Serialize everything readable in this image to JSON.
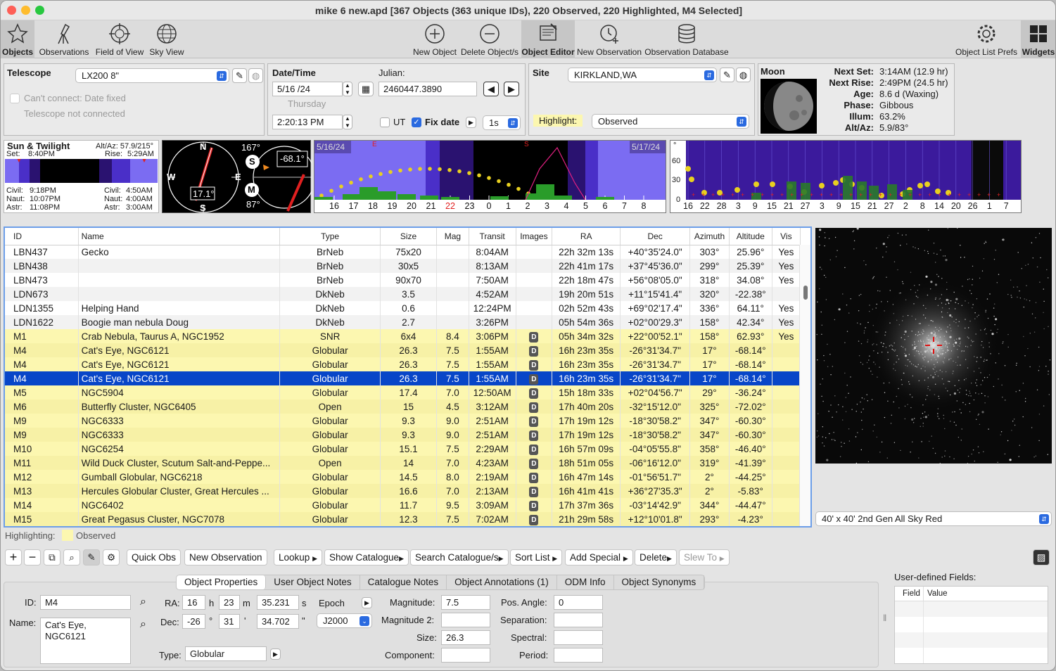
{
  "window": {
    "title": "mike 6 new.apd [367 Objects (363 unique IDs), 220 Observed, 220 Highlighted, M4 Selected]"
  },
  "toolbar": {
    "objects": "Objects",
    "observations": "Observations",
    "fov": "Field of View",
    "sky_view": "Sky View",
    "new_object": "New Object",
    "delete_objects": "Delete Object/s",
    "object_editor": "Object Editor",
    "new_observation": "New Observation",
    "obs_database": "Observation Database",
    "list_prefs": "Object List Prefs",
    "widgets": "Widgets"
  },
  "telescope": {
    "label": "Telescope",
    "value": "LX200 8\"",
    "cant_connect": "Can't connect: Date fixed",
    "status": "Telescope not connected"
  },
  "datetime": {
    "label": "Date/Time",
    "julian_label": "Julian:",
    "date": "5/16 /24",
    "weekday": "Thursday",
    "julian": "2460447.3890",
    "time": "2:20:13  PM",
    "ut": "UT",
    "fix_date": "Fix date",
    "step": "1s"
  },
  "site": {
    "label": "Site",
    "value": "KIRKLAND,WA",
    "highlight_label": "Highlight:",
    "highlight_value": "Observed"
  },
  "moon": {
    "label": "Moon",
    "rows": [
      {
        "k": "Next Set:",
        "v": "3:14AM (12.9 hr)"
      },
      {
        "k": "Next Rise:",
        "v": "2:49PM (24.5 hr)"
      },
      {
        "k": "Age:",
        "v": "8.6 d (Waxing)"
      },
      {
        "k": "Phase:",
        "v": "Gibbous"
      },
      {
        "k": "Illum:",
        "v": "63.2%"
      },
      {
        "k": "Alt/Az:",
        "v": "5.9/83°"
      }
    ]
  },
  "sun": {
    "title": "Sun & Twilight",
    "altaz": "Alt/Az: 57.9/215°",
    "set": "Set:",
    "set_time": "8:40PM",
    "rise": "Rise:",
    "rise_time": "5:29AM",
    "civil": "Civil:",
    "naut": "Naut:",
    "astr": "Astr:",
    "civil_e": "9:18PM",
    "naut_e": "10:07PM",
    "astr_e": "11:08PM",
    "civil_m": "4:50AM",
    "naut_m": "4:00AM",
    "astr_m": "3:00AM"
  },
  "compass": {
    "n": "N",
    "s": "S",
    "e": "E",
    "w": "W",
    "heading": "17.1°",
    "az1": "167°",
    "s_marker": "S",
    "m_marker": "M",
    "az2": "87°",
    "alt": "-68.1°"
  },
  "altchart": {
    "start": "5/16/24",
    "end": "5/17/24",
    "e": "E",
    "s": "S",
    "hours": [
      "16",
      "17",
      "18",
      "19",
      "20",
      "21",
      "22",
      "23",
      "0",
      "1",
      "2",
      "3",
      "4",
      "5",
      "6",
      "7",
      "8"
    ],
    "red_hour": "22"
  },
  "yearchart": {
    "y1": "60",
    "y2": "30",
    "y0": "0",
    "deg": "°",
    "ticks": [
      "16",
      "22",
      "28",
      "3",
      "9",
      "15",
      "21",
      "27",
      "3",
      "9",
      "15",
      "21",
      "27",
      "2",
      "8",
      "14",
      "20",
      "26",
      "1",
      "7"
    ]
  },
  "grid": {
    "headers": [
      "ID",
      "Name",
      "Type",
      "Size",
      "Mag",
      "Transit",
      "Images",
      "RA",
      "Dec",
      "Azimuth",
      "Altitude",
      "Vis"
    ],
    "rows": [
      {
        "id": "LBN437",
        "name": "Gecko",
        "type": "BrNeb",
        "size": "75x20",
        "mag": "",
        "transit": "8:04AM",
        "img": "",
        "ra": "22h 32m 13s",
        "dec": "+40°35'24.0\"",
        "az": "303°",
        "alt": "25.96°",
        "vis": "Yes",
        "state": "plain"
      },
      {
        "id": "LBN438",
        "name": "",
        "type": "BrNeb",
        "size": "30x5",
        "mag": "",
        "transit": "8:13AM",
        "img": "",
        "ra": "22h 41m 17s",
        "dec": "+37°45'36.0\"",
        "az": "299°",
        "alt": "25.39°",
        "vis": "Yes",
        "state": "alt"
      },
      {
        "id": "LBN473",
        "name": "",
        "type": "BrNeb",
        "size": "90x70",
        "mag": "",
        "transit": "7:50AM",
        "img": "",
        "ra": "22h 18m 47s",
        "dec": "+56°08'05.0\"",
        "az": "318°",
        "alt": "34.08°",
        "vis": "Yes",
        "state": "plain"
      },
      {
        "id": "LDN673",
        "name": "",
        "type": "DkNeb",
        "size": "3.5",
        "mag": "",
        "transit": "4:52AM",
        "img": "",
        "ra": "19h 20m 51s",
        "dec": "+11°15'41.4\"",
        "az": "320°",
        "alt": "-22.38°",
        "vis": "",
        "state": "alt"
      },
      {
        "id": "LDN1355",
        "name": "Helping Hand",
        "type": "DkNeb",
        "size": "0.6",
        "mag": "",
        "transit": "12:24PM",
        "img": "",
        "ra": "02h 52m 43s",
        "dec": "+69°02'17.4\"",
        "az": "336°",
        "alt": "64.11°",
        "vis": "Yes",
        "state": "plain"
      },
      {
        "id": "LDN1622",
        "name": "Boogie man nebula Doug",
        "type": "DkNeb",
        "size": "2.7",
        "mag": "",
        "transit": "3:26PM",
        "img": "",
        "ra": "05h 54m 36s",
        "dec": "+02°00'29.3\"",
        "az": "158°",
        "alt": "42.34°",
        "vis": "Yes",
        "state": "alt"
      },
      {
        "id": "M1",
        "name": "Crab Nebula, Taurus A, NGC1952",
        "type": "SNR",
        "size": "6x4",
        "mag": "8.4",
        "transit": "3:06PM",
        "img": "D",
        "ra": "05h 34m 32s",
        "dec": "+22°00'52.1\"",
        "az": "158°",
        "alt": "62.93°",
        "vis": "Yes",
        "state": "hl"
      },
      {
        "id": "M4",
        "name": "Cat's Eye, NGC6121",
        "type": "Globular",
        "size": "26.3",
        "mag": "7.5",
        "transit": "1:55AM",
        "img": "D",
        "ra": "16h 23m 35s",
        "dec": "-26°31'34.7\"",
        "az": "17°",
        "alt": "-68.14°",
        "vis": "",
        "state": "hl alt"
      },
      {
        "id": "M4",
        "name": "Cat's Eye, NGC6121",
        "type": "Globular",
        "size": "26.3",
        "mag": "7.5",
        "transit": "1:55AM",
        "img": "D",
        "ra": "16h 23m 35s",
        "dec": "-26°31'34.7\"",
        "az": "17°",
        "alt": "-68.14°",
        "vis": "",
        "state": "hl"
      },
      {
        "id": "M4",
        "name": "Cat's Eye, NGC6121",
        "type": "Globular",
        "size": "26.3",
        "mag": "7.5",
        "transit": "1:55AM",
        "img": "D",
        "ra": "16h 23m 35s",
        "dec": "-26°31'34.7\"",
        "az": "17°",
        "alt": "-68.14°",
        "vis": "",
        "state": "sel"
      },
      {
        "id": "M5",
        "name": "NGC5904",
        "type": "Globular",
        "size": "17.4",
        "mag": "7.0",
        "transit": "12:50AM",
        "img": "D",
        "ra": "15h 18m 33s",
        "dec": "+02°04'56.7\"",
        "az": "29°",
        "alt": "-36.24°",
        "vis": "",
        "state": "hl"
      },
      {
        "id": "M6",
        "name": "Butterfly Cluster, NGC6405",
        "type": "Open",
        "size": "15",
        "mag": "4.5",
        "transit": "3:12AM",
        "img": "D",
        "ra": "17h 40m 20s",
        "dec": "-32°15'12.0\"",
        "az": "325°",
        "alt": "-72.02°",
        "vis": "",
        "state": "hl alt"
      },
      {
        "id": "M9",
        "name": "NGC6333",
        "type": "Globular",
        "size": "9.3",
        "mag": "9.0",
        "transit": "2:51AM",
        "img": "D",
        "ra": "17h 19m 12s",
        "dec": "-18°30'58.2\"",
        "az": "347°",
        "alt": "-60.30°",
        "vis": "",
        "state": "hl"
      },
      {
        "id": "M9",
        "name": "NGC6333",
        "type": "Globular",
        "size": "9.3",
        "mag": "9.0",
        "transit": "2:51AM",
        "img": "D",
        "ra": "17h 19m 12s",
        "dec": "-18°30'58.2\"",
        "az": "347°",
        "alt": "-60.30°",
        "vis": "",
        "state": "hl alt"
      },
      {
        "id": "M10",
        "name": "NGC6254",
        "type": "Globular",
        "size": "15.1",
        "mag": "7.5",
        "transit": "2:29AM",
        "img": "D",
        "ra": "16h 57m 09s",
        "dec": "-04°05'55.8\"",
        "az": "358°",
        "alt": "-46.40°",
        "vis": "",
        "state": "hl"
      },
      {
        "id": "M11",
        "name": "Wild Duck Cluster, Scutum Salt-and-Peppe...",
        "type": "Open",
        "size": "14",
        "mag": "7.0",
        "transit": "4:23AM",
        "img": "D",
        "ra": "18h 51m 05s",
        "dec": "-06°16'12.0\"",
        "az": "319°",
        "alt": "-41.39°",
        "vis": "",
        "state": "hl alt"
      },
      {
        "id": "M12",
        "name": "Gumball Globular, NGC6218",
        "type": "Globular",
        "size": "14.5",
        "mag": "8.0",
        "transit": "2:19AM",
        "img": "D",
        "ra": "16h 47m 14s",
        "dec": "-01°56'51.7\"",
        "az": "2°",
        "alt": "-44.25°",
        "vis": "",
        "state": "hl"
      },
      {
        "id": "M13",
        "name": "Hercules Globular Cluster, Great Hercules ...",
        "type": "Globular",
        "size": "16.6",
        "mag": "7.0",
        "transit": "2:13AM",
        "img": "D",
        "ra": "16h 41m 41s",
        "dec": "+36°27'35.3\"",
        "az": "2°",
        "alt": "-5.83°",
        "vis": "",
        "state": "hl alt"
      },
      {
        "id": "M14",
        "name": "NGC6402",
        "type": "Globular",
        "size": "11.7",
        "mag": "9.5",
        "transit": "3:09AM",
        "img": "D",
        "ra": "17h 37m 36s",
        "dec": "-03°14'42.9\"",
        "az": "344°",
        "alt": "-44.47°",
        "vis": "",
        "state": "hl"
      },
      {
        "id": "M15",
        "name": "Great Pegasus Cluster, NGC7078",
        "type": "Globular",
        "size": "12.3",
        "mag": "7.5",
        "transit": "7:02AM",
        "img": "D",
        "ra": "21h 29m 58s",
        "dec": "+12°10'01.8\"",
        "az": "293°",
        "alt": "-4.23°",
        "vis": "",
        "state": "hl alt"
      }
    ]
  },
  "image": {
    "survey": "40' x 40'  2nd Gen All Sky Red"
  },
  "highlighting": {
    "label": "Highlighting:",
    "value": "Observed"
  },
  "actions": {
    "quick_obs": "Quick Obs",
    "new_obs": "New Observation",
    "lookup": "Lookup",
    "show_cat": "Show Catalogue",
    "search_cat": "Search Catalogue/s",
    "sort": "Sort List",
    "add_special": "Add Special",
    "delete": "Delete",
    "slew": "Slew To"
  },
  "tabs": [
    "Object Properties",
    "User Object Notes",
    "Catalogue Notes",
    "Object Annotations (1)",
    "ODM Info",
    "Object Synonyms"
  ],
  "props": {
    "id_label": "ID:",
    "id": "M4",
    "name_label": "Name:",
    "name": "Cat's Eye, NGC6121",
    "ra_label": "RA:",
    "ra_h": "16",
    "h": "h",
    "ra_m": "23",
    "m": "m",
    "ra_s": "35.231",
    "s": "s",
    "epoch_label": "Epoch",
    "dec_label": "Dec:",
    "dec_d": "-26",
    "deg": "°",
    "dec_m": "31",
    "min": "'",
    "dec_s": "34.702",
    "sec": "\"",
    "epoch": "J2000",
    "type_label": "Type:",
    "type": "Globular",
    "mag_label": "Magnitude:",
    "mag": "7.5",
    "mag2_label": "Magnitude 2:",
    "mag2": "",
    "size_label": "Size:",
    "size": "26.3",
    "comp_label": "Component:",
    "comp": "",
    "pa_label": "Pos. Angle:",
    "pa": "0",
    "sep_label": "Separation:",
    "sep": "",
    "spec_label": "Spectral:",
    "spec": "",
    "period_label": "Period:",
    "period": ""
  },
  "udf": {
    "title": "User-defined Fields:",
    "field": "Field",
    "value": "Value"
  },
  "colors": {
    "highlight": "#fcf7b0",
    "selection": "#0846c8",
    "focus": "#6c9ee8",
    "chart_purple": "#3b1a9c"
  }
}
